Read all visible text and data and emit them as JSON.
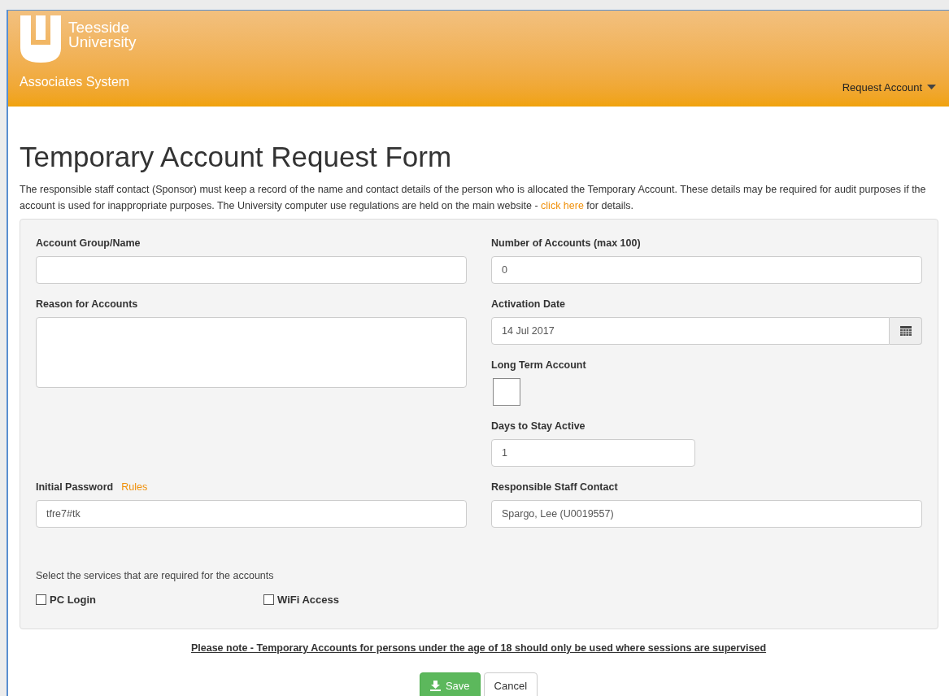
{
  "header": {
    "logo_line1": "Teesside",
    "logo_line2": "University",
    "system_name": "Associates System",
    "menu": {
      "label": "Request Account"
    }
  },
  "title": "Temporary Account Request Form",
  "intro": {
    "before": "The responsible staff contact (Sponsor) must keep a record of the name and contact details of the person who is allocated the Temporary Account. These details may be required for audit purposes if the account is used for inappropriate purposes. The University computer use regulations are held on the main website - ",
    "link": "click here",
    "after": " for details."
  },
  "form": {
    "account_group": {
      "label": "Account Group/Name"
    },
    "number_of_accounts": {
      "label": "Number of Accounts (max 100)",
      "value": "0"
    },
    "reason": {
      "label": "Reason for Accounts"
    },
    "activation_date": {
      "label": "Activation Date",
      "value": "14 Jul 2017"
    },
    "long_term": {
      "label": "Long Term Account",
      "checked": false
    },
    "days_active": {
      "label": "Days to Stay Active",
      "value": "1"
    },
    "initial_password": {
      "label": "Initial Password",
      "link": "Rules",
      "value": "tfre7#tk"
    },
    "staff_contact": {
      "label": "Responsible Staff Contact",
      "value": "Spargo, Lee (U0019557)"
    },
    "services_prompt": "Select the services that are required for the accounts",
    "services": [
      {
        "label": "PC Login",
        "checked": false
      },
      {
        "label": "WiFi Access",
        "checked": false
      }
    ]
  },
  "note": "Please note - Temporary Accounts for persons under the age of 18 should only be used where sessions are supervised",
  "buttons": {
    "save": "Save",
    "cancel": "Cancel"
  }
}
